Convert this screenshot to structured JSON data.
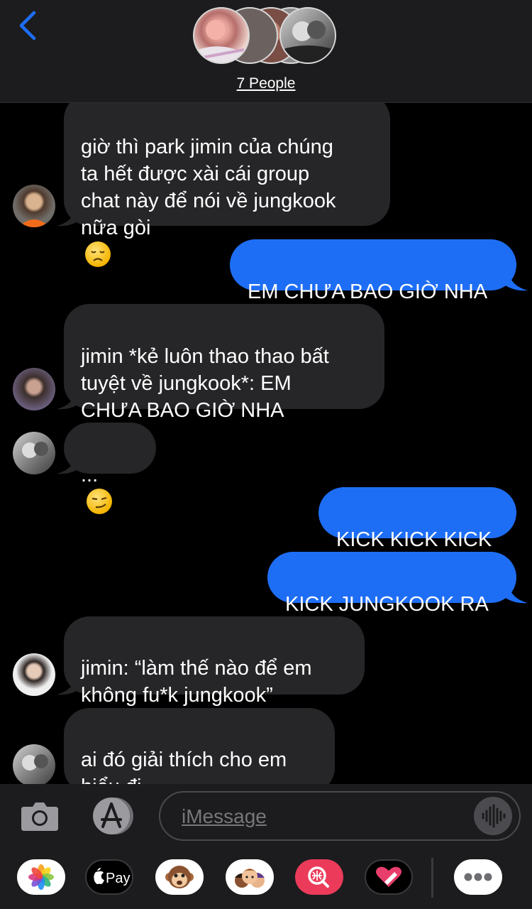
{
  "header": {
    "group_label": "7 People",
    "back_icon": "chevron-left-icon",
    "accent_color": "#1e6ef5"
  },
  "messages": [
    {
      "side": "in",
      "text": "giờ thì park jimin của chúng\nta hết được xài cái group\nchat này để nói về jungkook\nnữa gòi",
      "emoji": "disappointed-face"
    },
    {
      "side": "out",
      "text": "EM CHƯA BAO GIỜ NHA"
    },
    {
      "side": "in",
      "text": "jimin *kẻ luôn thao thao bất\ntuyệt về jungkook*: EM\nCHƯA BAO GIỜ NHA"
    },
    {
      "side": "in",
      "text": "...",
      "emoji": "smirking-face"
    },
    {
      "side": "out",
      "text": "KICK KICK KICK"
    },
    {
      "side": "out",
      "text": "KICK JUNGKOOK RA"
    },
    {
      "side": "in",
      "text": "jimin: “làm thế nào để em\nkhông fu*k jungkook”"
    },
    {
      "side": "in",
      "text": "ai đó giải thích cho em\nhiểu đi"
    }
  ],
  "composer": {
    "placeholder": "iMessage",
    "camera_icon": "camera-icon",
    "apps_icon": "app-store-icon",
    "audio_icon": "audio-waveform-icon"
  },
  "app_drawer": {
    "items": [
      {
        "name": "photos-app-icon"
      },
      {
        "name": "apple-pay-app-icon",
        "label": "Pay"
      },
      {
        "name": "animoji-app-icon"
      },
      {
        "name": "memoji-app-icon"
      },
      {
        "name": "gif-search-app-icon"
      },
      {
        "name": "digital-touch-app-icon"
      },
      {
        "name": "more-apps-icon"
      }
    ]
  }
}
